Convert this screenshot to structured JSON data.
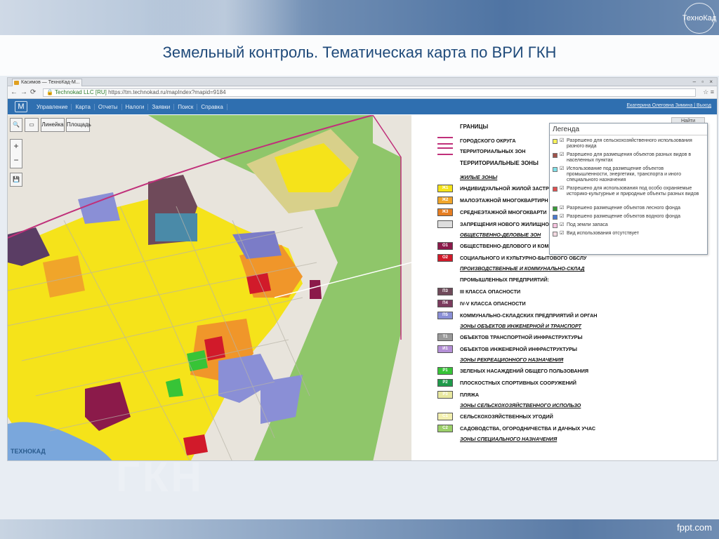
{
  "slide": {
    "title": "Земельный контроль. Тематическая карта по ВРИ ГКН",
    "brand": "ТехноКад",
    "footer": "fppt.com",
    "ghost_text": "ГКН"
  },
  "browser": {
    "tab_title": "Касимов — ТехноКад-М...",
    "url_secure": "Technokad LLC [RU]",
    "url": "https://tm.technokad.ru/mapIndex?mapid=9184",
    "window_controls": "– ▫ ×"
  },
  "app": {
    "menu": [
      "Управление",
      "Карта",
      "Отчеты",
      "Налоги",
      "Заявки",
      "Поиск",
      "Справка"
    ],
    "user": "Екатерина Олеговна Зимина | Выход",
    "find_button": "Найти",
    "tools": {
      "ruler": "Линейка",
      "area": "Площадь"
    },
    "zoom": {
      "plus": "+",
      "minus": "−"
    },
    "watermark": "ТЕХНОКАД"
  },
  "colors": {
    "residential": "#f5e31a",
    "midrise": "#f0962a",
    "business": "#8b1a4a",
    "industrial": "#6f4a5a",
    "forest": "#8fcf6a",
    "green": "#37c437",
    "water": "#7aa7dc",
    "accent": "#2f6fb0"
  },
  "map_legend": {
    "borders_head": "ГРАНИЦЫ",
    "borders": [
      "ГОРОДСКОГО ОКРУГА",
      "ТЕРРИТОРИАЛЬНЫХ ЗОН"
    ],
    "zones_head": "ТЕРРИТОРИАЛЬНЫЕ ЗОНЫ",
    "sections": [
      {
        "title": "ЖИЛЫЕ ЗОНЫ",
        "items": [
          {
            "code": "Ж1",
            "color": "#f5e31a",
            "label": "ИНДИВИДУАЛЬНОЙ ЖИЛОЙ ЗАСТРО"
          },
          {
            "code": "Ж2",
            "color": "#f0a52a",
            "label": "МАЛОЭТАЖНОЙ МНОГОКВАРТИРН"
          },
          {
            "code": "Ж3",
            "color": "#e67e22",
            "label": "СРЕДНЕЭТАЖНОЙ МНОГОКВАРТИ"
          },
          {
            "code": "",
            "color": "#dddddd",
            "label": "ЗАПРЕЩЕНИЯ НОВОГО ЖИЛИЩНО"
          }
        ]
      },
      {
        "title": "ОБЩЕСТВЕННО-ДЕЛОВЫЕ ЗОН",
        "items": [
          {
            "code": "О1",
            "color": "#8b1a4a",
            "label": "ОБЩЕСТВЕННО-ДЕЛОВОГО И КОММЕРЧЕСКОГО НА"
          },
          {
            "code": "О2",
            "color": "#d11a2a",
            "label": "СОЦИАЛЬНОГО И КУЛЬТУРНО-БЫТОВОГО ОБСЛУ"
          }
        ]
      },
      {
        "title": "ПРОИЗВОДСТВЕННЫЕ И КОММУНАЛЬНО-СКЛАД",
        "items": [
          {
            "code": "",
            "color": "",
            "label": "ПРОМЫШЛЕННЫХ ПРЕДПРИЯТИЙ:"
          },
          {
            "code": "П3",
            "color": "#6f4a5a",
            "label": "III КЛАССА ОПАСНОСТИ"
          },
          {
            "code": "П4",
            "color": "#7b3b5e",
            "label": "IV-V КЛАССА ОПАСНОСТИ"
          },
          {
            "code": "П5",
            "color": "#8a8fd6",
            "label": "КОММУНАЛЬНО-СКЛАДСКИХ ПРЕДПРИЯТИЙ И ОРГАН"
          }
        ]
      },
      {
        "title": "ЗОНЫ ОБЪЕКТОВ ИНЖЕНЕРНОЙ И ТРАНСПОРТ",
        "items": [
          {
            "code": "Т1",
            "color": "#9a9a9a",
            "label": "ОБЪЕКТОВ ТРАНСПОРТНОЙ ИНФРАСТРУКТУРЫ"
          },
          {
            "code": "И1",
            "color": "#b48fd6",
            "label": "ОБЪЕКТОВ ИНЖЕНЕРНОЙ ИНФРАСТРУКТУРЫ"
          }
        ]
      },
      {
        "title": "ЗОНЫ РЕКРЕАЦИОННОГО НАЗНАЧЕНИЯ",
        "items": [
          {
            "code": "Р1",
            "color": "#37c437",
            "label": "ЗЕЛЕНЫХ НАСАЖДЕНИЙ ОБЩЕГО ПОЛЬЗОВАНИЯ"
          },
          {
            "code": "Р2",
            "color": "#1f9a4a",
            "label": "ПЛОСКОСТНЫХ СПОРТИВНЫХ СООРУЖЕНИЙ"
          },
          {
            "code": "Р3",
            "color": "#e8e8a0",
            "label": "ПЛЯЖА"
          }
        ]
      },
      {
        "title": "ЗОНЫ СЕЛЬСКОХОЗЯЙСТВЕННОГО ИСПОЛЬЗО",
        "items": [
          {
            "code": "С1",
            "color": "#f3f0b0",
            "label": "СЕЛЬСКОХОЗЯЙСТВЕННЫХ УГОДИЙ"
          },
          {
            "code": "С2",
            "color": "#9ccf6a",
            "label": "САДОВОДСТВА, ОГОРОДНИЧЕСТВА И ДАЧНЫХ УЧАС"
          }
        ]
      },
      {
        "title": "ЗОНЫ СПЕЦИАЛЬНОГО НАЗНАЧЕНИЯ",
        "items": []
      }
    ]
  },
  "legend_popup": {
    "title": "Легенда",
    "items": [
      {
        "color": "#f7f25a",
        "label": "Разрешено для сельскохозяйственного использования разного вида"
      },
      {
        "color": "#a0524a",
        "label": "Разрешено для размещения объектов разных видов в населенных пунктах"
      },
      {
        "color": "#7fe0e8",
        "label": "Использование под размещение объектов промышленности, энергетики, транспорта и иного специального назначения"
      },
      {
        "color": "#e05050",
        "label": "Разрешено для использования под особо охраняемые историко-культурные и природные объекты разных видов"
      },
      {
        "color": "#3a9a3a",
        "label": "Разрешено размещение объектов лесного фонда"
      },
      {
        "color": "#4a7ad0",
        "label": "Разрешено размещение объектов водного фонда"
      },
      {
        "color": "#f7c3e0",
        "label": "Под земли запаса"
      },
      {
        "color": "#f2d8e0",
        "label": "Вид использования отсутствует"
      }
    ]
  }
}
